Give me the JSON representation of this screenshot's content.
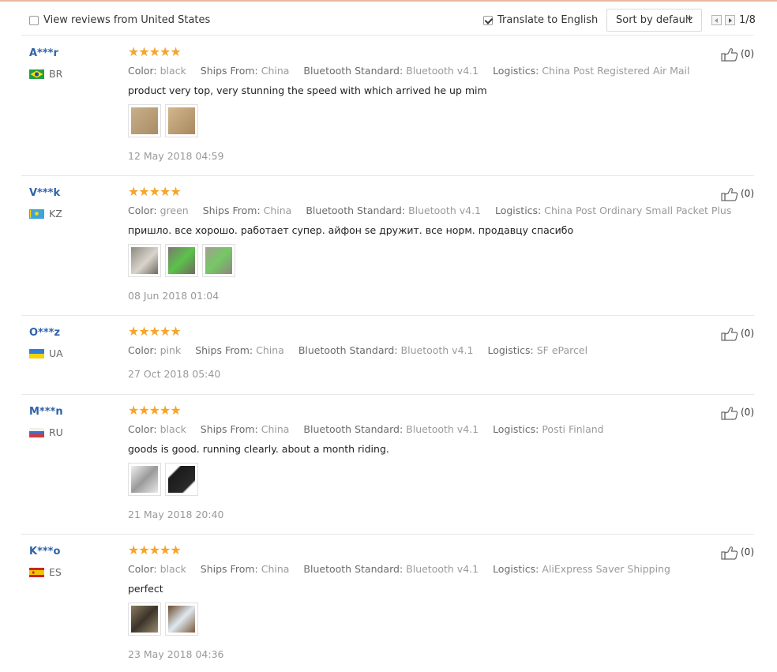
{
  "filters": {
    "view_us_label": "View reviews from United States",
    "view_us_checked": false,
    "translate_label": "Translate to English",
    "translate_checked": true,
    "sort_label": "Sort by default",
    "page_indicator": "1/8"
  },
  "field_labels": {
    "color": "Color:",
    "ships_from": "Ships From:",
    "bluetooth": "Bluetooth Standard:",
    "logistics": "Logistics:"
  },
  "stars_text": "★★★★★",
  "colors": {
    "star": "#f7a428",
    "user_name": "#2f62a8"
  },
  "reviews": [
    {
      "user": "A***r",
      "country": "BR",
      "flag_icon": "brazil-flag-icon",
      "rating": 5,
      "color": "black",
      "ships_from": "China",
      "bluetooth": "Bluetooth v4.1",
      "logistics": "China Post Registered Air Mail",
      "feedback": "product very top, very stunning the speed with which arrived he up mim",
      "photo_count": 2,
      "date": "12 May 2018 04:59",
      "helpful": "(0)"
    },
    {
      "user": "V***k",
      "country": "KZ",
      "flag_icon": "kazakhstan-flag-icon",
      "rating": 5,
      "color": "green",
      "ships_from": "China",
      "bluetooth": "Bluetooth v4.1",
      "logistics": "China Post Ordinary Small Packet Plus",
      "feedback": "пришло. все хорошо. работает супер. айфон se дружит. все норм. продавцу спасибо",
      "photo_count": 3,
      "date": "08 Jun 2018 01:04",
      "helpful": "(0)"
    },
    {
      "user": "O***z",
      "country": "UA",
      "flag_icon": "ukraine-flag-icon",
      "rating": 5,
      "color": "pink",
      "ships_from": "China",
      "bluetooth": "Bluetooth v4.1",
      "logistics": "SF eParcel",
      "feedback": "",
      "photo_count": 0,
      "date": "27 Oct 2018 05:40",
      "helpful": "(0)"
    },
    {
      "user": "M***n",
      "country": "RU",
      "flag_icon": "russia-flag-icon",
      "rating": 5,
      "color": "black",
      "ships_from": "China",
      "bluetooth": "Bluetooth v4.1",
      "logistics": "Posti Finland",
      "feedback": "goods is good. running clearly. about a month riding.",
      "photo_count": 2,
      "date": "21 May 2018 20:40",
      "helpful": "(0)"
    },
    {
      "user": "K***o",
      "country": "ES",
      "flag_icon": "spain-flag-icon",
      "rating": 5,
      "color": "black",
      "ships_from": "China",
      "bluetooth": "Bluetooth v4.1",
      "logistics": "AliExpress Saver Shipping",
      "feedback": "perfect",
      "photo_count": 2,
      "date": "23 May 2018 04:36",
      "helpful": "(0)"
    }
  ]
}
